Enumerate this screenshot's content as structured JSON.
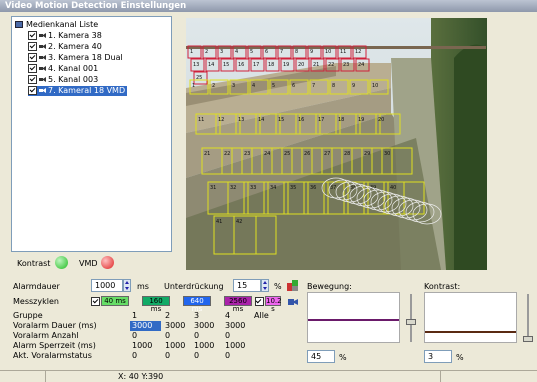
{
  "window": {
    "title": "Video Motion Detection Einstellungen"
  },
  "tree": {
    "root": "Medienkanal Liste",
    "items": [
      {
        "label": "1. Kamera 38",
        "selected": false
      },
      {
        "label": "2. Kamera 40",
        "selected": false
      },
      {
        "label": "3. Kamera 18 Dual",
        "selected": false
      },
      {
        "label": "4. Kanal 001",
        "selected": false
      },
      {
        "label": "5. Kanal 003",
        "selected": false
      },
      {
        "label": "7. Kameral 18 VMD",
        "selected": true
      }
    ]
  },
  "indicators": {
    "kontrast_label": "Kontrast",
    "kontrast_color": "#22bb22",
    "vmd_label": "VMD",
    "vmd_color": "#dd2222"
  },
  "video": {
    "zones_red": [
      "1",
      "2",
      "3",
      "4",
      "5",
      "6",
      "7",
      "8",
      "9",
      "10",
      "11",
      "12",
      "13",
      "14",
      "15",
      "16",
      "17",
      "18",
      "19",
      "20",
      "21",
      "22",
      "23",
      "24",
      "25"
    ],
    "zones_yellow": [
      "1",
      "2",
      "3",
      "4",
      "5",
      "6",
      "7",
      "8",
      "9",
      "10",
      "11",
      "12",
      "13",
      "14",
      "15",
      "16",
      "17",
      "18",
      "19",
      "20",
      "21",
      "22",
      "23",
      "24",
      "25",
      "26",
      "27",
      "28",
      "29",
      "30",
      "31",
      "32",
      "33",
      "34",
      "35",
      "36",
      "37",
      "38",
      "39",
      "40",
      "41",
      "42"
    ]
  },
  "settings": {
    "alarmdauer_label": "Alarmdauer",
    "alarmdauer_value": "1000",
    "alarmdauer_unit": "ms",
    "unterdrueckung_label": "Unterdrückung",
    "unterdrueckung_value": "15",
    "unterdrueckung_unit": "%",
    "messzyklen_label": "Messzyklen",
    "cycles": [
      {
        "label": "40 ms",
        "color": "#66dd66",
        "checked": false
      },
      {
        "label": "160 ms",
        "color": "#11aa66",
        "checked": true
      },
      {
        "label": "640 ms",
        "color": "#2266ee",
        "checked": true
      },
      {
        "label": "2560 ms",
        "color": "#aa22aa",
        "checked": false
      },
      {
        "label": "10.2 s",
        "color": "#ee66ee",
        "checked": false
      }
    ]
  },
  "table": {
    "columns": [
      "1",
      "2",
      "3",
      "4",
      "Alle"
    ],
    "rows": [
      {
        "label": "Gruppe",
        "values": []
      },
      {
        "label": "Voralarm Dauer (ms)",
        "values": [
          "3000",
          "3000",
          "3000",
          "3000"
        ]
      },
      {
        "label": "Voralarm Anzahl",
        "values": [
          "0",
          "0",
          "0",
          "0"
        ]
      },
      {
        "label": "Alarm Sperrzeit (ms)",
        "values": [
          "1000",
          "1000",
          "1000",
          "1000"
        ]
      },
      {
        "label": "Akt. Voralarmstatus",
        "values": [
          "0",
          "0",
          "0",
          "0"
        ]
      }
    ]
  },
  "bewegung": {
    "title": "Bewegung:",
    "value": "45",
    "unit": "%",
    "level": 0.45,
    "bar_color": "#6a1a6a"
  },
  "kontrast_panel": {
    "title": "Kontrast:",
    "value": "3",
    "unit": "%",
    "level": 0.03,
    "bar_color": "#5a2a12"
  },
  "status": {
    "coords": "X: 40 Y:390"
  }
}
